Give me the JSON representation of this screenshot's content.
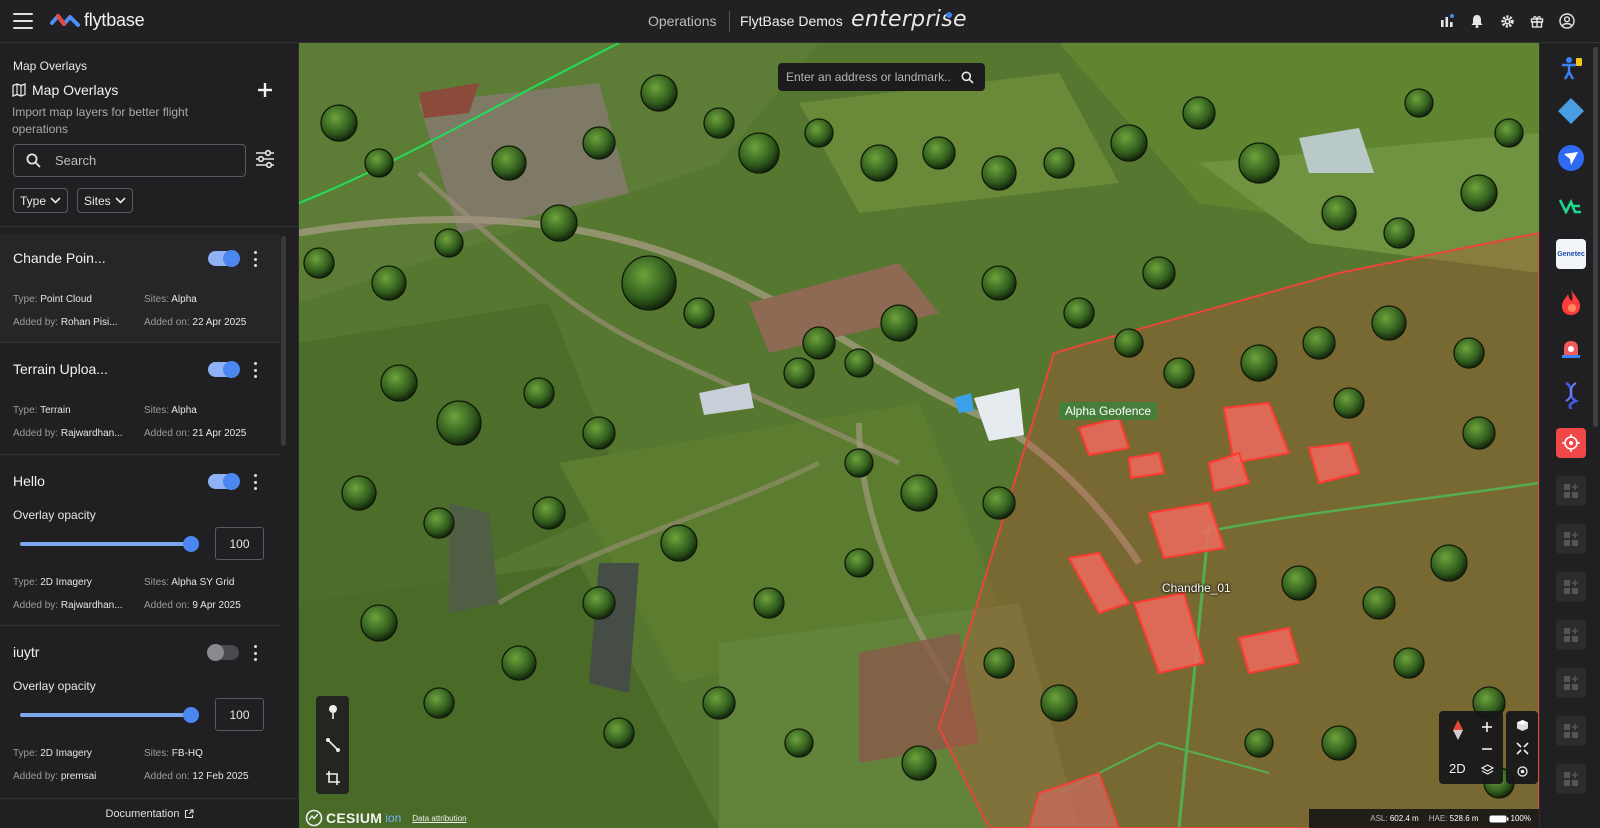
{
  "topbar": {
    "logo_text": "flytbase",
    "nav_operations": "Operations",
    "org_name": "FlytBase Demos",
    "plan_label": "enterprise",
    "icons": [
      "analytics-icon",
      "bell-icon",
      "gear-icon",
      "gift-icon",
      "user-circle-icon"
    ]
  },
  "sidebar": {
    "breadcrumb": "Map Overlays",
    "title": "Map Overlays",
    "description": "Import map layers for better flight operations",
    "search_placeholder": "Search",
    "filters": {
      "type_label": "Type",
      "sites_label": "Sites"
    },
    "type_prefix": "Type:",
    "sites_prefix": "Sites:",
    "added_by_prefix": "Added by:",
    "added_on_prefix": "Added on:",
    "opacity_label": "Overlay opacity",
    "overlays": [
      {
        "name": "Chande Poin...",
        "enabled": true,
        "type": "Point Cloud",
        "sites": "Alpha",
        "added_by": "Rohan Pisi...",
        "added_on": "22 Apr 2025"
      },
      {
        "name": "Terrain Uploa...",
        "enabled": true,
        "type": "Terrain",
        "sites": "Alpha",
        "added_by": "Rajwardhan...",
        "added_on": "21 Apr 2025"
      },
      {
        "name": "Hello",
        "enabled": true,
        "opacity": "100",
        "type": "2D Imagery",
        "sites": "Alpha SY Grid",
        "added_by": "Rajwardhan...",
        "added_on": "9 Apr 2025"
      },
      {
        "name": "iuytr",
        "enabled": false,
        "opacity": "100",
        "type": "2D Imagery",
        "sites": "FB-HQ",
        "added_by": "premsai",
        "added_on": "12 Feb 2025"
      }
    ],
    "documentation_label": "Documentation"
  },
  "map": {
    "search_placeholder": "Enter an address or landmark...",
    "labels": {
      "geofence": "Alpha Geofence",
      "site": "Chandhe_01"
    },
    "attribution": {
      "cesium": "CESIUM",
      "ion": "ion",
      "data_attribution": "Data attribution"
    },
    "controls": {
      "mode_2d": "2D"
    },
    "status": {
      "asl_label": "ASL:",
      "asl_value": "602.4 m",
      "hae_label": "HAE:",
      "hae_value": "528.6 m",
      "battery": "100%"
    }
  },
  "rail": {
    "apps": [
      "accessibility-app-icon",
      "diamond-app-icon",
      "send-app-icon",
      "va-app-icon",
      "genetec-app-icon",
      "fire-app-icon",
      "alarm-app-icon",
      "dna-app-icon",
      "sensor-app-icon"
    ],
    "genetec_text": "Genetec",
    "placeholder_count": 7
  },
  "colors": {
    "accent": "#4c86f0",
    "geofence": "#e8463a",
    "panel": "#202023"
  }
}
